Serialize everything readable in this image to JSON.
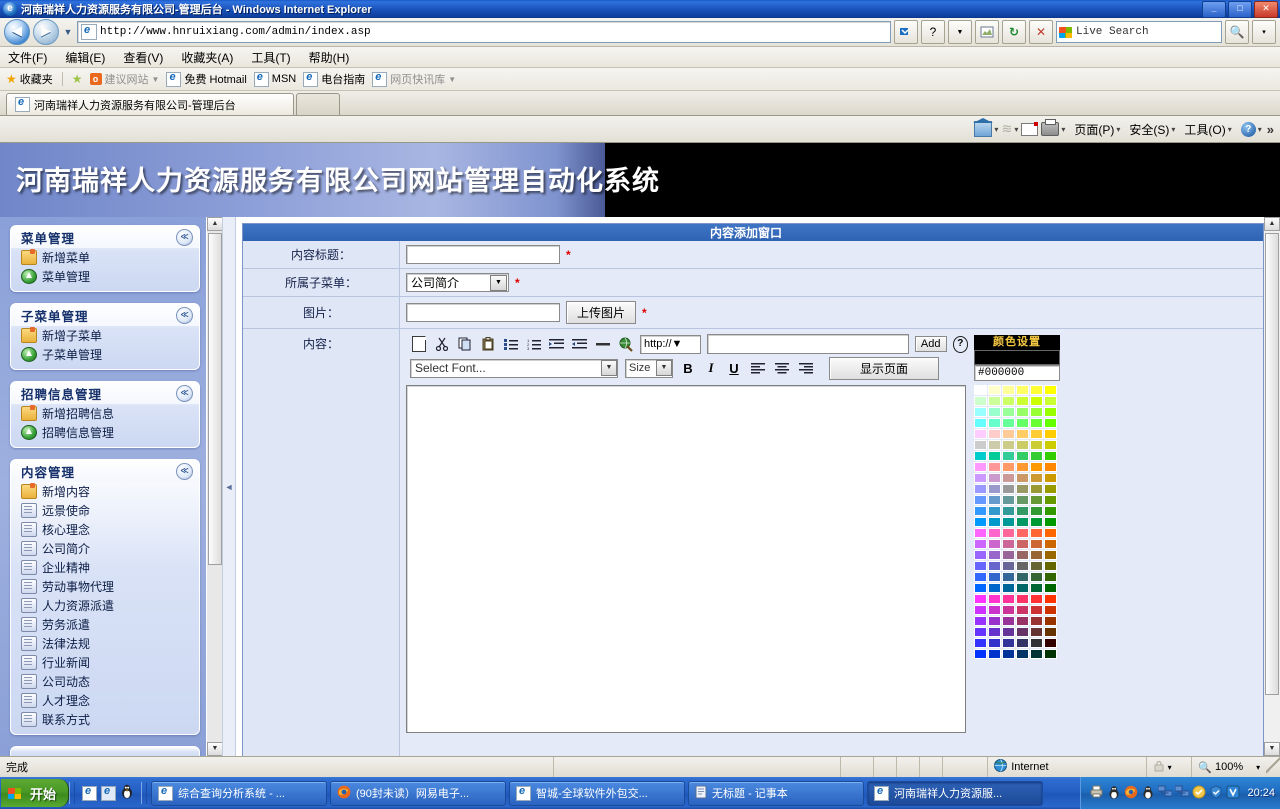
{
  "window": {
    "title": "河南瑞祥人力资源服务有限公司-管理后台 - Windows Internet Explorer",
    "minimize": "_",
    "maximize": "□",
    "close": "✕"
  },
  "nav": {
    "back": "◀",
    "forward": "▶",
    "dropdown": "▼",
    "url": "http://www.hnruixiang.com/admin/index.asp",
    "stop": "✕",
    "refresh": "↻",
    "compat": "⛶",
    "search_placeholder": "Live Search",
    "search_go": "🔍",
    "search_caret": "▾"
  },
  "menubar": [
    "文件(F)",
    "编辑(E)",
    "查看(V)",
    "收藏夹(A)",
    "工具(T)",
    "帮助(H)"
  ],
  "favbar": {
    "label": "收藏夹",
    "items": [
      {
        "label": "建议网站",
        "icon": "orange-o-icon",
        "dim": true,
        "caret": true
      },
      {
        "label": "免费 Hotmail",
        "icon": "ie-icon",
        "dim": false,
        "caret": false
      },
      {
        "label": "MSN",
        "icon": "ie-icon",
        "dim": false,
        "caret": false
      },
      {
        "label": "电台指南",
        "icon": "ie-icon",
        "dim": false,
        "caret": false
      },
      {
        "label": "网页快讯库",
        "icon": "ie-icon",
        "dim": true,
        "caret": true
      }
    ]
  },
  "tabs": [
    {
      "label": "河南瑞祥人力资源服务有限公司-管理后台"
    }
  ],
  "commandbar": {
    "home": "",
    "home_caret": "▾",
    "feeds": "",
    "feeds_caret": "▾",
    "mail": "",
    "print": "",
    "print_caret": "▾",
    "page": "页面(P)",
    "page_caret": "▾",
    "safety": "安全(S)",
    "safety_caret": "▾",
    "tools": "工具(O)",
    "tools_caret": "▾",
    "help_caret": "▾",
    "overflow": "»"
  },
  "banner": {
    "title": "河南瑞祥人力资源服务有限公司网站管理自动化系统"
  },
  "sidebar": {
    "sections": [
      {
        "title": "菜单管理",
        "collapse": "≪",
        "items": [
          {
            "label": "新增菜单",
            "icon": "folder-icon"
          },
          {
            "label": "菜单管理",
            "icon": "globe-up-icon"
          }
        ]
      },
      {
        "title": "子菜单管理",
        "collapse": "≪",
        "items": [
          {
            "label": "新增子菜单",
            "icon": "folder-icon"
          },
          {
            "label": "子菜单管理",
            "icon": "globe-up-icon"
          }
        ]
      },
      {
        "title": "招聘信息管理",
        "collapse": "≪",
        "items": [
          {
            "label": "新增招聘信息",
            "icon": "folder-icon"
          },
          {
            "label": "招聘信息管理",
            "icon": "globe-up-icon"
          }
        ]
      },
      {
        "title": "内容管理",
        "collapse": "≪",
        "items": [
          {
            "label": "新增内容",
            "icon": "folder-icon"
          },
          {
            "label": "远景使命",
            "icon": "doc-icon"
          },
          {
            "label": "核心理念",
            "icon": "doc-icon"
          },
          {
            "label": "公司简介",
            "icon": "doc-icon"
          },
          {
            "label": "企业精神",
            "icon": "doc-icon"
          },
          {
            "label": "劳动事物代理",
            "icon": "doc-icon"
          },
          {
            "label": "人力资源派遣",
            "icon": "doc-icon"
          },
          {
            "label": "劳务派遣",
            "icon": "doc-icon"
          },
          {
            "label": "法律法规",
            "icon": "doc-icon"
          },
          {
            "label": "行业新闻",
            "icon": "doc-icon"
          },
          {
            "label": "公司动态",
            "icon": "doc-icon"
          },
          {
            "label": "人才理念",
            "icon": "doc-icon"
          },
          {
            "label": "联系方式",
            "icon": "doc-icon"
          }
        ]
      }
    ]
  },
  "form": {
    "header": "内容添加窗口",
    "title_label": "内容标题：",
    "title_value": "",
    "title_required": "*",
    "submenu_label": "所属子菜单：",
    "submenu_value": "公司简介",
    "submenu_arrow": "▼",
    "submenu_required": "*",
    "image_label": "图片：",
    "image_value": "",
    "upload_button": "上传图片",
    "image_required": "*",
    "content_label": "内容："
  },
  "editor": {
    "toolbar_icons": [
      {
        "name": "new-page-icon",
        "glyph": ""
      },
      {
        "name": "cut-icon",
        "glyph": "✂"
      },
      {
        "name": "copy-icon",
        "glyph": "⧉"
      },
      {
        "name": "paste-icon",
        "glyph": "📋"
      },
      {
        "name": "bullet-list-icon",
        "glyph": "☰"
      },
      {
        "name": "numbered-list-icon",
        "glyph": "≡"
      },
      {
        "name": "indent-icon",
        "glyph": "⇥"
      },
      {
        "name": "outdent-icon",
        "glyph": "⇤"
      },
      {
        "name": "horizontal-rule-icon",
        "glyph": "—"
      },
      {
        "name": "insert-link-icon",
        "glyph": "🌐"
      }
    ],
    "url_scheme": "http://",
    "url_scheme_arrow": "▼",
    "url_value": "",
    "add_button": "Add",
    "help_button": "?",
    "font_select": "Select Font...",
    "font_arrow": "▼",
    "size_select": "Size",
    "size_arrow": "▼",
    "bold": "B",
    "italic": "I",
    "underline": "U",
    "align_left": "align-left-icon",
    "align_center": "align-center-icon",
    "align_right": "align-right-icon",
    "preview_button": "显示页面",
    "body_value": ""
  },
  "colorpicker": {
    "header": "颜色设置",
    "preview": "#000000",
    "value": "#000000",
    "swatches": [
      "#ffffff",
      "#ffffcc",
      "#ffff99",
      "#ffff66",
      "#ffff33",
      "#ffff00",
      "#ccffcc",
      "#ccff99",
      "#ccff66",
      "#ccff33",
      "#ccff00",
      "#ccff33",
      "#99ffff",
      "#99ffcc",
      "#99ff99",
      "#99ff66",
      "#99ff33",
      "#99ff00",
      "#66ffff",
      "#66ffcc",
      "#66ff99",
      "#66ff66",
      "#66ff33",
      "#66ff00",
      "#ffccff",
      "#ffcccc",
      "#ffcc99",
      "#ffcc66",
      "#ffcc33",
      "#ffcc00",
      "#cccccc",
      "#ccccaa",
      "#cccc88",
      "#cccc66",
      "#cccc33",
      "#cccc00",
      "#00cccc",
      "#00cc99",
      "#33cc99",
      "#33cc66",
      "#33cc33",
      "#33cc00",
      "#ff99ff",
      "#ff9999",
      "#ff9966",
      "#ff9933",
      "#ff9900",
      "#ff8800",
      "#cc99ff",
      "#cc99cc",
      "#cc9999",
      "#cc9966",
      "#cc9933",
      "#cc9900",
      "#9999ff",
      "#9999cc",
      "#999999",
      "#999966",
      "#999933",
      "#999900",
      "#6699ff",
      "#6699cc",
      "#669999",
      "#669966",
      "#669933",
      "#669900",
      "#3399ff",
      "#3399cc",
      "#339999",
      "#339966",
      "#339933",
      "#339900",
      "#0099ff",
      "#0099cc",
      "#009999",
      "#009966",
      "#009933",
      "#009900",
      "#ff66ff",
      "#ff66cc",
      "#ff6699",
      "#ff6666",
      "#ff6633",
      "#ff6600",
      "#cc66ff",
      "#cc66cc",
      "#cc6699",
      "#cc6666",
      "#cc6633",
      "#cc6600",
      "#9966ff",
      "#9966cc",
      "#996699",
      "#996666",
      "#996633",
      "#996600",
      "#6666ff",
      "#6666cc",
      "#666699",
      "#666666",
      "#666633",
      "#666600",
      "#3366ff",
      "#3366cc",
      "#336699",
      "#336666",
      "#336633",
      "#336600",
      "#0066ff",
      "#0066cc",
      "#006699",
      "#006666",
      "#006633",
      "#006600",
      "#ff33ff",
      "#ff33cc",
      "#ff3399",
      "#ff3366",
      "#ff3333",
      "#ff3300",
      "#cc33ff",
      "#cc33cc",
      "#cc3399",
      "#cc3366",
      "#cc3333",
      "#cc3300",
      "#9933ff",
      "#9933cc",
      "#993399",
      "#993366",
      "#993333",
      "#993300",
      "#6633ff",
      "#6633cc",
      "#663399",
      "#663366",
      "#663333",
      "#663300",
      "#3333ff",
      "#3333cc",
      "#333399",
      "#333366",
      "#333333",
      "#330000",
      "#0033ff",
      "#0033cc",
      "#003399",
      "#003366",
      "#003333",
      "#003300"
    ]
  },
  "statusbar": {
    "text": "完成",
    "zone": "Internet",
    "zone_icon": "globe-icon",
    "protect_caret": "▾",
    "zoom": "100%",
    "zoom_caret": "▾"
  },
  "taskbar": {
    "start": "开始",
    "quicklaunch": [
      "ie-icon",
      "ie2-icon",
      "qq-penguin-icon"
    ],
    "tasks": [
      {
        "label": "综合查询分析系统 - ...",
        "icon": "ie-icon",
        "active": false
      },
      {
        "label": "(90封未读）网易电子...",
        "icon": "firefox-icon",
        "active": false
      },
      {
        "label": "智城-全球软件外包交...",
        "icon": "ie-icon",
        "active": false
      },
      {
        "label": "无标题 - 记事本",
        "icon": "notepad-icon",
        "active": false
      },
      {
        "label": "河南瑞祥人力资源服...",
        "icon": "ie-icon",
        "active": true
      }
    ],
    "tray": [
      "printer-icon",
      "qq-icon",
      "firefox-icon",
      "qq2-icon",
      "network-icon",
      "network2-icon",
      "shield-yellow-icon",
      "shield-blue-icon",
      "defender-icon"
    ],
    "clock": "20:24"
  }
}
